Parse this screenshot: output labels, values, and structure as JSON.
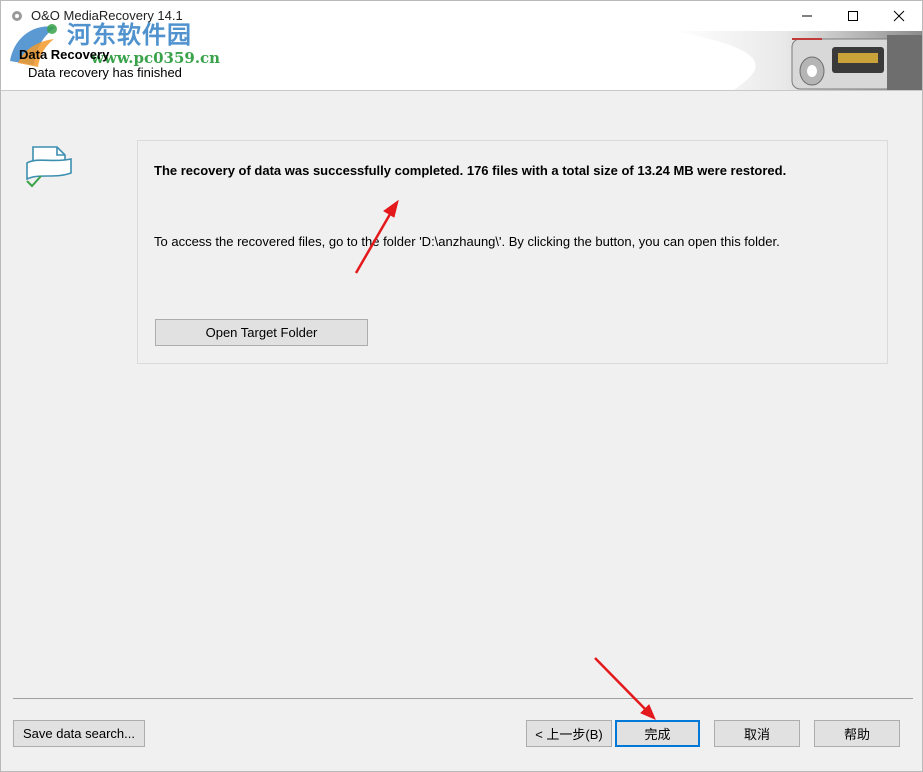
{
  "window": {
    "title": "O&O MediaRecovery 14.1",
    "controls": {
      "minimize": "minimize-icon",
      "maximize": "maximize-icon",
      "close": "close-icon"
    }
  },
  "header": {
    "title": "Data Recovery",
    "subtitle": "Data recovery has finished"
  },
  "watermark": {
    "text": "河东软件园",
    "url": "www.pc0359.cn"
  },
  "panel": {
    "headline": "The recovery of data was successfully completed. 176 files with a total size of 13.24 MB were restored.",
    "info": "To access the recovered files, go to the folder 'D:\\anzhaung\\'. By clicking the button, you can open this folder.",
    "open_folder_label": "Open Target Folder"
  },
  "footer": {
    "save_label": "Save data search...",
    "back_label": "< 上一步(B)",
    "finish_label": "完成",
    "cancel_label": "取消",
    "help_label": "帮助"
  },
  "colors": {
    "accent": "#0078d7",
    "annotation_arrow": "#e3191c",
    "watermark_blue": "#3d87c9",
    "watermark_green": "#3aa24a"
  }
}
